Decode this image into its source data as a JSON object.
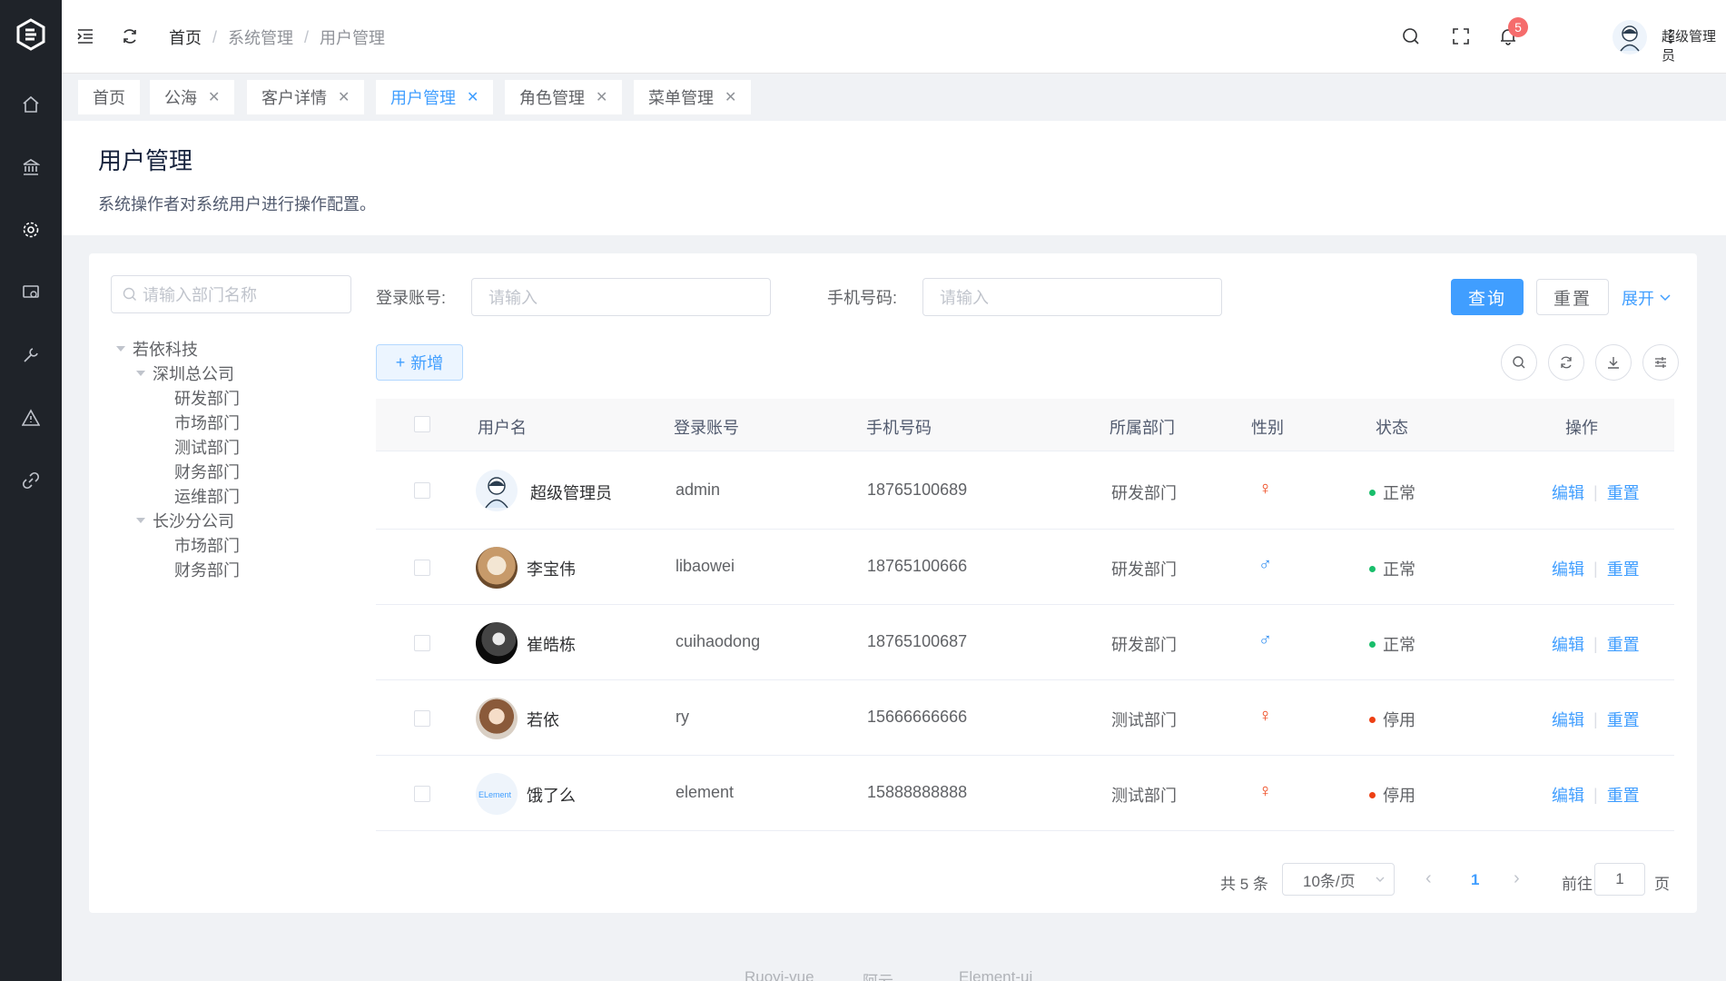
{
  "breadcrumb": [
    "首页",
    "系统管理",
    "用户管理"
  ],
  "header": {
    "badge_count": "5",
    "user_name": "超级管理员"
  },
  "tabs": [
    {
      "label": "首页",
      "closable": false,
      "active": false
    },
    {
      "label": "公海",
      "closable": true,
      "active": false
    },
    {
      "label": "客户详情",
      "closable": true,
      "active": false
    },
    {
      "label": "用户管理",
      "closable": true,
      "active": true
    },
    {
      "label": "角色管理",
      "closable": true,
      "active": false
    },
    {
      "label": "菜单管理",
      "closable": true,
      "active": false
    }
  ],
  "page": {
    "title": "用户管理",
    "description": "系统操作者对系统用户进行操作配置。"
  },
  "dept_search": {
    "placeholder": "请输入部门名称"
  },
  "tree": [
    {
      "label": "若依科技",
      "expanded": true
    },
    {
      "label": "深圳总公司",
      "expanded": true
    },
    {
      "label": "研发部门"
    },
    {
      "label": "市场部门"
    },
    {
      "label": "测试部门"
    },
    {
      "label": "财务部门"
    },
    {
      "label": "运维部门"
    },
    {
      "label": "长沙分公司",
      "expanded": true
    },
    {
      "label": "市场部门"
    },
    {
      "label": "财务部门"
    }
  ],
  "search": {
    "account_label": "登录账号:",
    "account_placeholder": "请输入",
    "phone_label": "手机号码:",
    "phone_placeholder": "请输入",
    "query_label": "查询",
    "reset_label": "重置",
    "expand_label": "展开"
  },
  "toolbar": {
    "add_label": "新增"
  },
  "table": {
    "columns": [
      "用户名",
      "登录账号",
      "手机号码",
      "所属部门",
      "性别",
      "状态",
      "操作"
    ],
    "rows": [
      {
        "name": "超级管理员",
        "account": "admin",
        "phone": "18765100689",
        "dept": "研发部门",
        "gender": "♀",
        "status": "正常",
        "status_color": "#19be6b",
        "edit": "编辑",
        "reset": "重置"
      },
      {
        "name": "李宝伟",
        "account": "libaowei",
        "phone": "18765100666",
        "dept": "研发部门",
        "gender": "♂",
        "status": "正常",
        "status_color": "#19be6b",
        "edit": "编辑",
        "reset": "重置"
      },
      {
        "name": "崔皓栋",
        "account": "cuihaodong",
        "phone": "18765100687",
        "dept": "研发部门",
        "gender": "♂",
        "status": "正常",
        "status_color": "#19be6b",
        "edit": "编辑",
        "reset": "重置"
      },
      {
        "name": "若依",
        "account": "ry",
        "phone": "15666666666",
        "dept": "测试部门",
        "gender": "♀",
        "status": "停用",
        "status_color": "#ed4014",
        "edit": "编辑",
        "reset": "重置"
      },
      {
        "name": "饿了么",
        "account": "element",
        "phone": "15888888888",
        "dept": "测试部门",
        "gender": "♀",
        "status": "停用",
        "status_color": "#ed4014",
        "edit": "编辑",
        "reset": "重置"
      }
    ]
  },
  "pagination": {
    "total_text": "共 5 条",
    "page_size": "10条/页",
    "current_page": "1",
    "goto_label": "前往",
    "goto_value": "1",
    "page_unit": "页"
  },
  "footer": {
    "links": [
      "Ruoyi-vue",
      "阿云",
      "Element-ui"
    ]
  },
  "colors": {
    "accent": "#409eff",
    "sidebar": "#1f2329",
    "female": "#ed4014",
    "male": "#2d8cf0"
  }
}
